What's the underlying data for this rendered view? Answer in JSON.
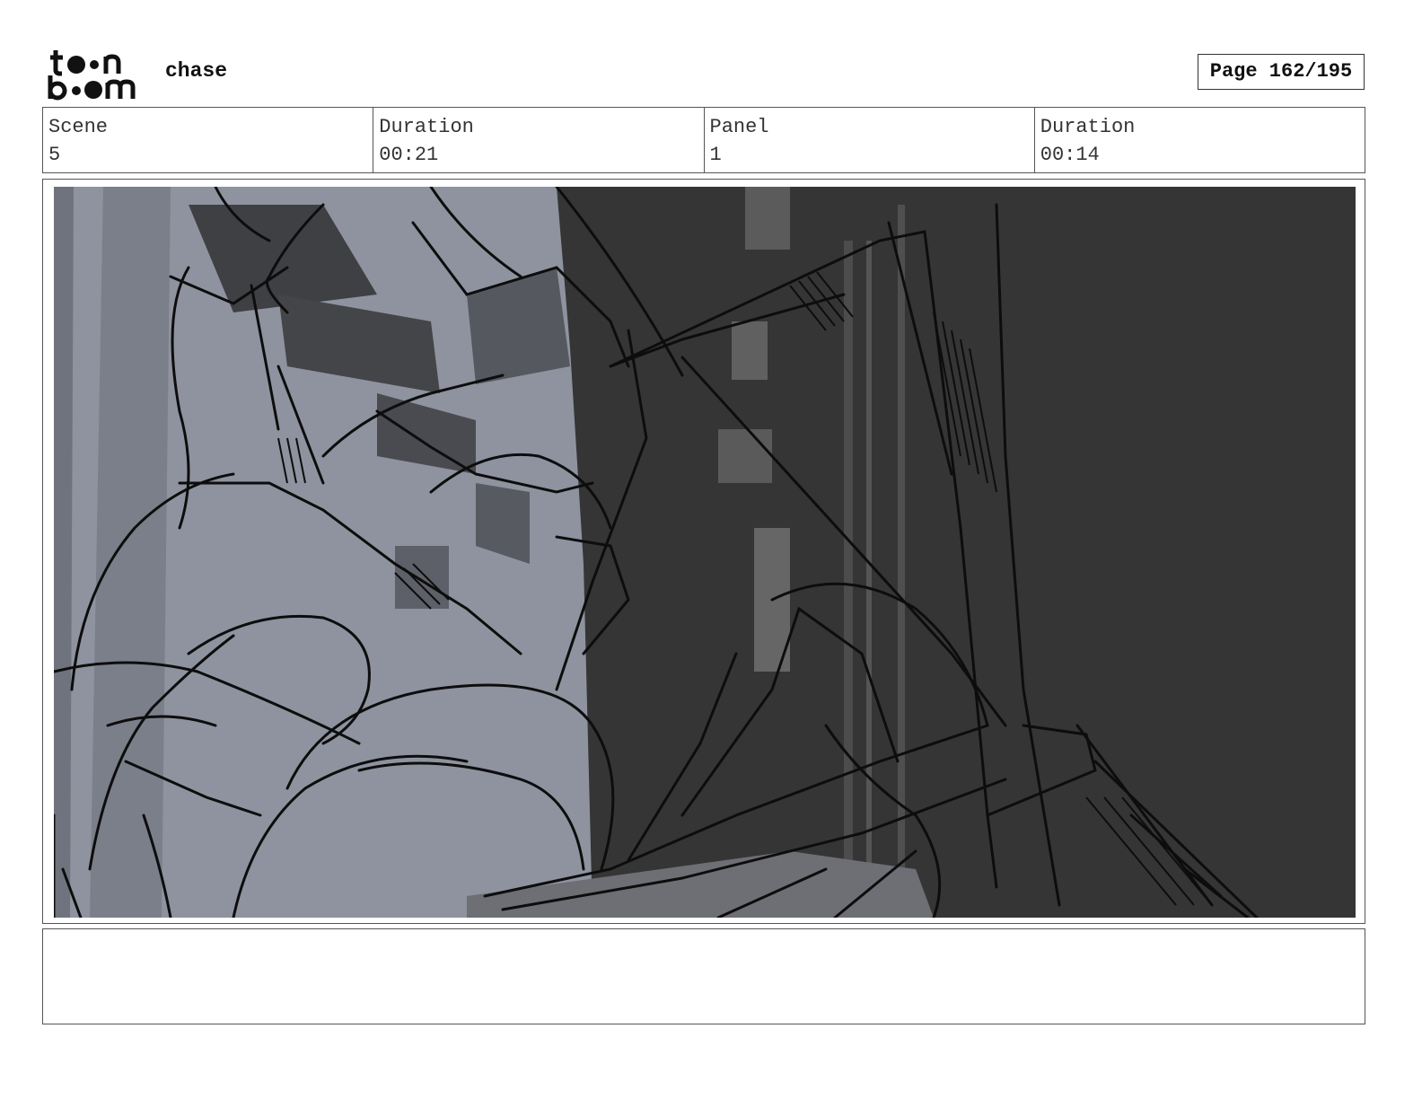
{
  "header": {
    "logo_text_top": "toon",
    "logo_text_bottom": "boom",
    "project_title": "chase",
    "page_label": "Page 162/195"
  },
  "info": {
    "scene_label": "Scene",
    "scene_value": "5",
    "scene_duration_label": "Duration",
    "scene_duration_value": "00:21",
    "panel_label": "Panel",
    "panel_value": "1",
    "panel_duration_label": "Duration",
    "panel_duration_value": "00:14"
  },
  "panel": {
    "colors": {
      "light_wall": "#8e939f",
      "mid_wall": "#747985",
      "dark_shadow": "#3c3c3d",
      "background_dark": "#353535",
      "line": "#0d0d0d"
    }
  },
  "notes": {
    "text": ""
  }
}
